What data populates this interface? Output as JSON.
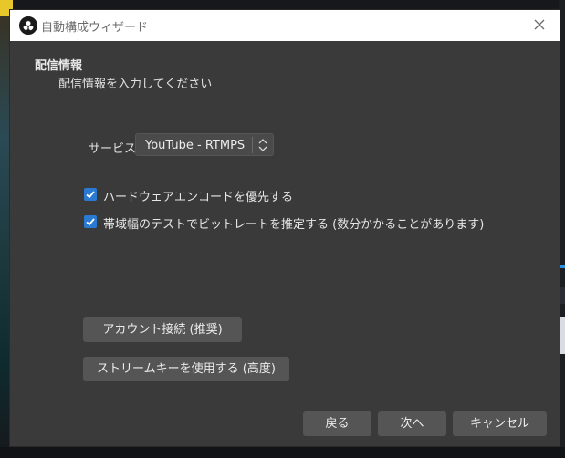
{
  "window": {
    "title": "自動構成ウィザード",
    "close_icon": "close-icon"
  },
  "section": {
    "title": "配信情報",
    "subtitle": "配信情報を入力してください"
  },
  "service": {
    "label": "サービス",
    "selected": "YouTube - RTMPS"
  },
  "options": [
    {
      "label": "ハードウェアエンコードを優先する",
      "checked": true
    },
    {
      "label": "帯域幅のテストでビットレートを推定する (数分かかることがあります)",
      "checked": true
    }
  ],
  "buttons": {
    "connect_account": "アカウント接続 (推奨)",
    "use_stream_key": "ストリームキーを使用する (高度)",
    "back": "戻る",
    "next": "次へ",
    "cancel": "キャンセル"
  },
  "colors": {
    "dialog_bg": "#3a3a3a",
    "button_bg": "#555555",
    "checkbox_accent": "#2a7ad1",
    "titlebar_bg": "#ffffff"
  }
}
